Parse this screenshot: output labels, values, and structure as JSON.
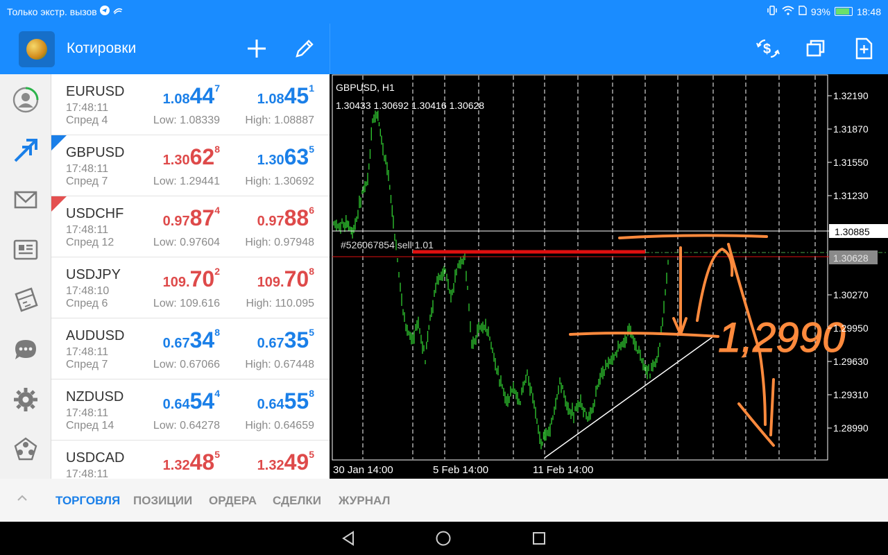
{
  "status": {
    "left_text": "Только экстр. вызов",
    "battery_pct": "93%",
    "time": "18:48"
  },
  "toolbar": {
    "title": "Котировки",
    "left_icons": [
      "add-icon",
      "edit-icon"
    ],
    "right_icons": [
      "currency-exchange-icon",
      "windows-icon",
      "new-order-icon"
    ]
  },
  "rail": [
    "account-icon",
    "trade-arrows-icon",
    "mail-icon",
    "news-icon",
    "calendar-icon",
    "chat-icon",
    "settings-icon",
    "community-icon"
  ],
  "quotes": [
    {
      "symbol": "EURUSD",
      "time": "17:48:11",
      "spread": "Спред 4",
      "bid": {
        "a": "1.08",
        "b": "44",
        "c": "7",
        "color": "blue"
      },
      "ask": {
        "a": "1.08",
        "b": "45",
        "c": "1",
        "color": "blue"
      },
      "low": "Low: 1.08339",
      "high": "High: 1.08887",
      "arrow": ""
    },
    {
      "symbol": "GBPUSD",
      "time": "17:48:11",
      "spread": "Спред 7",
      "bid": {
        "a": "1.30",
        "b": "62",
        "c": "8",
        "color": "red"
      },
      "ask": {
        "a": "1.30",
        "b": "63",
        "c": "5",
        "color": "blue"
      },
      "low": "Low: 1.29441",
      "high": "High: 1.30692",
      "arrow": "up"
    },
    {
      "symbol": "USDCHF",
      "time": "17:48:11",
      "spread": "Спред 12",
      "bid": {
        "a": "0.97",
        "b": "87",
        "c": "4",
        "color": "red"
      },
      "ask": {
        "a": "0.97",
        "b": "88",
        "c": "6",
        "color": "red"
      },
      "low": "Low: 0.97604",
      "high": "High: 0.97948",
      "arrow": "down"
    },
    {
      "symbol": "USDJPY",
      "time": "17:48:10",
      "spread": "Спред 6",
      "bid": {
        "a": "109.",
        "b": "70",
        "c": "2",
        "color": "red"
      },
      "ask": {
        "a": "109.",
        "b": "70",
        "c": "8",
        "color": "red"
      },
      "low": "Low: 109.616",
      "high": "High: 110.095",
      "arrow": ""
    },
    {
      "symbol": "AUDUSD",
      "time": "17:48:11",
      "spread": "Спред 7",
      "bid": {
        "a": "0.67",
        "b": "34",
        "c": "8",
        "color": "blue"
      },
      "ask": {
        "a": "0.67",
        "b": "35",
        "c": "5",
        "color": "blue"
      },
      "low": "Low: 0.67066",
      "high": "High: 0.67448",
      "arrow": ""
    },
    {
      "symbol": "NZDUSD",
      "time": "17:48:11",
      "spread": "Спред 14",
      "bid": {
        "a": "0.64",
        "b": "54",
        "c": "4",
        "color": "blue"
      },
      "ask": {
        "a": "0.64",
        "b": "55",
        "c": "8",
        "color": "blue"
      },
      "low": "Low: 0.64278",
      "high": "High: 0.64659",
      "arrow": ""
    },
    {
      "symbol": "USDCAD",
      "time": "17:48:11",
      "spread": "",
      "bid": {
        "a": "1.32",
        "b": "48",
        "c": "5",
        "color": "red"
      },
      "ask": {
        "a": "1.32",
        "b": "49",
        "c": "5",
        "color": "red"
      },
      "low": "",
      "high": "",
      "arrow": ""
    }
  ],
  "chart": {
    "symbol_tf": "GBPUSD, H1",
    "ohlc": "1.30433 1.30692 1.30416 1.30628",
    "y_ticks": [
      "1.32190",
      "1.31870",
      "1.31550",
      "1.31230",
      "1.30270",
      "1.29950",
      "1.29630",
      "1.29310",
      "1.28990"
    ],
    "x_ticks": [
      "30 Jan 14:00",
      "5 Feb 14:00",
      "11 Feb 14:00"
    ],
    "crosshair_price": "1.30885",
    "current_price": "1.30628",
    "order_label": "#526067854 sell 1.01",
    "annotation": "1,2990",
    "colors": {
      "candles": "#2ec12e",
      "order_line": "#e01010",
      "bid_line": "#e01010",
      "drawing": "#ff8a3d",
      "trendline": "#ffffff"
    }
  },
  "tabs": [
    "ТОРГОВЛЯ",
    "ПОЗИЦИИ",
    "ОРДЕРА",
    "СДЕЛКИ",
    "ЖУРНАЛ"
  ],
  "active_tab": "ТОРГОВЛЯ"
}
